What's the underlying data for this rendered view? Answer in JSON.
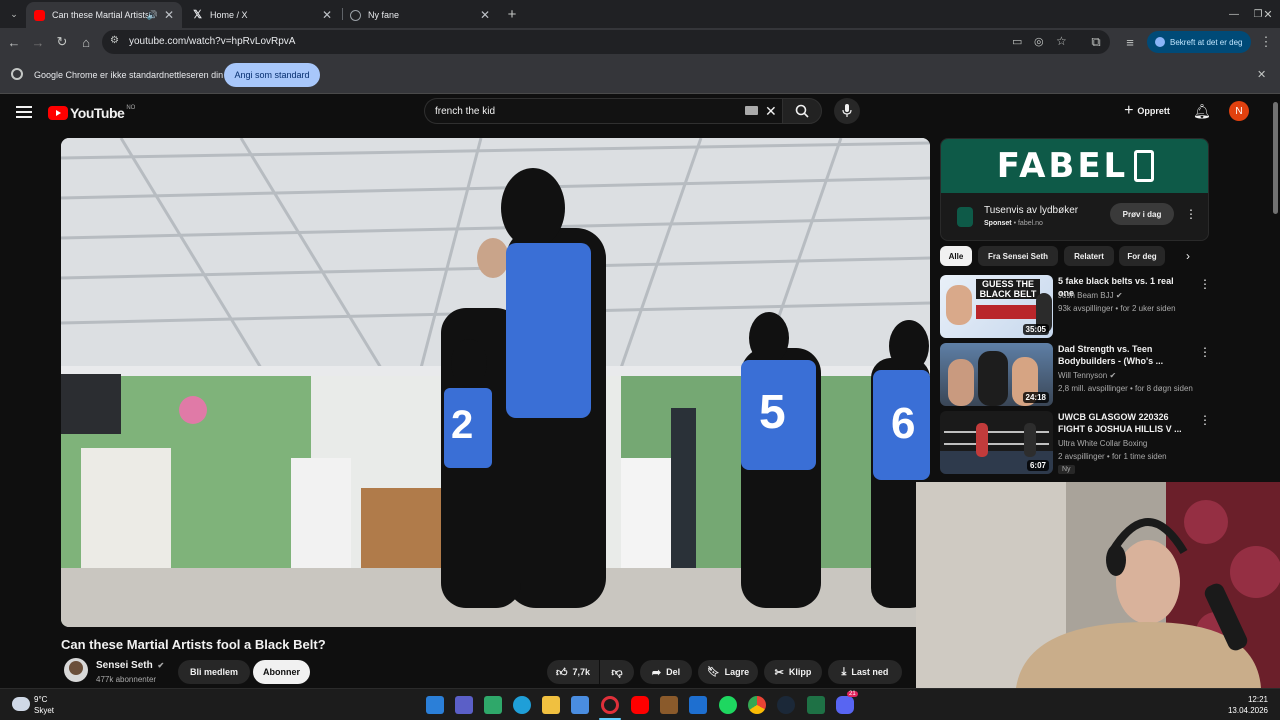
{
  "browser": {
    "tabs": [
      {
        "title": "Can these Martial Artists fo",
        "active": true
      },
      {
        "title": "Home / X",
        "active": false
      },
      {
        "title": "Ny fane",
        "active": false
      }
    ],
    "new_tab_symbol": "+",
    "url": "youtube.com/watch?v=hpRvLovRpvA",
    "verify_label": "Bekreft at det er deg",
    "infobar": {
      "message": "Google Chrome er ikke standardnettleseren din",
      "button": "Angi som standard"
    }
  },
  "youtube": {
    "logo_text": "YouTube",
    "country_code": "NO",
    "search_query": "french the kid",
    "create_label": "Opprett",
    "avatar_letter": "N",
    "video": {
      "title": "Can these Martial Artists fool a Black Belt?",
      "channel": "Sensei Seth",
      "subscribers": "477k abonnenter",
      "join_label": "Bli medlem",
      "subscribe_label": "Abonner",
      "likes": "7,7k",
      "share_label": "Del",
      "save_label": "Lagre",
      "clip_label": "Klipp",
      "download_label": "Last ned",
      "vest_numbers": [
        "2",
        "5",
        "6"
      ]
    },
    "ad": {
      "brand": "FABEL",
      "headline": "Tusenvis av lydbøker",
      "sponsored": "Sponset",
      "domain": "fabel.no",
      "cta": "Prøv i dag"
    },
    "chips": [
      "Alle",
      "Fra Sensei Seth",
      "Relatert",
      "For deg"
    ],
    "recommendations": [
      {
        "title": "5 fake black belts vs. 1 real one",
        "channel": "Josh Beam BJJ",
        "verified": true,
        "meta": "93k avspillinger • for 2 uker siden",
        "duration": "35:05",
        "thumb_text": "GUESS THE BLACK BELT"
      },
      {
        "title": "Dad Strength vs. Teen Bodybuilders - (Who's ...",
        "channel": "Will Tennyson",
        "verified": true,
        "meta": "2,8 mill. avspillinger • for 8 døgn siden",
        "duration": "24:18",
        "thumb_text": ""
      },
      {
        "title": "UWCB GLASGOW 220326 FIGHT 6 JOSHUA HILLIS V ...",
        "channel": "Ultra White Collar Boxing",
        "verified": false,
        "meta": "2 avspillinger • for 1 time siden",
        "duration": "6:07",
        "badge": "Ny",
        "thumb_text": ""
      }
    ]
  },
  "taskbar": {
    "temperature": "9°C",
    "weather": "Skyet",
    "time": "12:21",
    "date": "13.04.2026",
    "notification_count": "21"
  },
  "colors": {
    "accent_red": "#ff0000",
    "ad_green": "#0e5a48",
    "chip_selected": "#f1f1f1"
  }
}
